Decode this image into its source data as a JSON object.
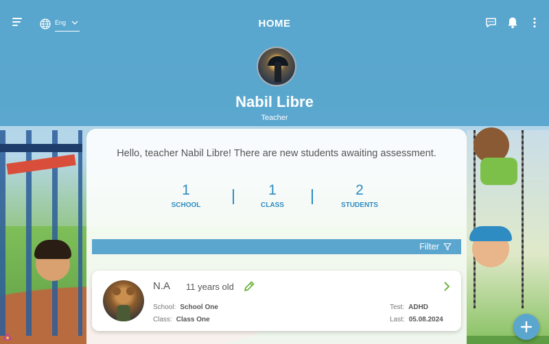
{
  "header": {
    "title": "HOME",
    "language": "Eng",
    "user_name": "Nabil Libre",
    "user_role": "Teacher"
  },
  "icons": {
    "menu": "menu-icon",
    "language": "globe-icon",
    "language_dropdown": "chevron-down-icon",
    "messages": "chat-icon",
    "notifications": "bell-icon",
    "more": "more-vertical-icon",
    "filter": "filter-icon",
    "edit": "pencil-icon",
    "open": "chevron-right-icon",
    "add": "plus-icon"
  },
  "colors": {
    "accent": "#2e8cc2",
    "header_bg": "#4ea0cb",
    "filter_bg": "#5aa6cf",
    "edit_green": "#6cb33f"
  },
  "main": {
    "greeting": "Hello, teacher Nabil Libre! There are new students awaiting assessment.",
    "stats": [
      {
        "value": "1",
        "label": "SCHOOL"
      },
      {
        "value": "1",
        "label": "CLASS"
      },
      {
        "value": "2",
        "label": "STUDENTS"
      }
    ],
    "filter_label": "Filter"
  },
  "students": [
    {
      "name": "N.A",
      "age": "11 years old",
      "school_label": "School:",
      "school": "School One",
      "class_label": "Class:",
      "class": "Class One",
      "test_label": "Test:",
      "test": "ADHD",
      "last_label": "Last:",
      "last": "05.08.2024"
    }
  ]
}
